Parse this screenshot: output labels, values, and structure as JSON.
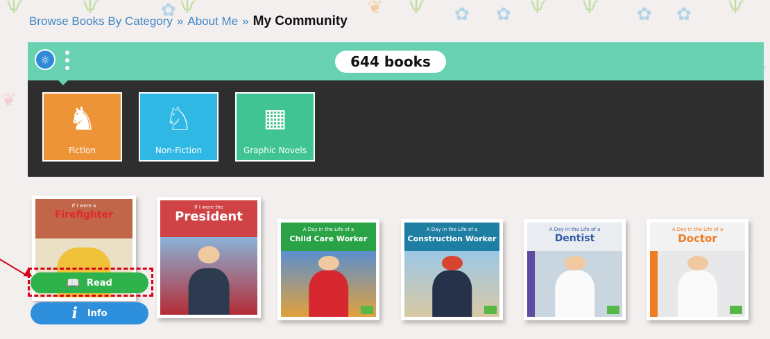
{
  "breadcrumb": {
    "items": [
      "Browse Books By Category",
      "About Me"
    ],
    "separator": "»",
    "current": "My Community"
  },
  "panel": {
    "book_count": "644 books",
    "filter_icon": "lightbulb-icon",
    "categories": [
      {
        "label": "Fiction",
        "icon": "unicorn-icon",
        "color": "#ed9438"
      },
      {
        "label": "Non-Fiction",
        "icon": "horse-icon",
        "color": "#2fb8e4"
      },
      {
        "label": "Graphic Novels",
        "icon": "comic-panel-icon",
        "color": "#40c494"
      }
    ]
  },
  "books": [
    {
      "title_small": "If I were a",
      "title": "Firefighter"
    },
    {
      "title_small": "If I were the",
      "title": "President"
    },
    {
      "title_small": "A Day in the Life of a",
      "title": "Child Care Worker"
    },
    {
      "title_small": "A Day in the Life of a",
      "title": "Construction Worker"
    },
    {
      "title_small": "A Day in the Life of a",
      "title": "Dentist"
    },
    {
      "title_small": "A Day in the Life of a",
      "title": "Doctor"
    }
  ],
  "actions": {
    "read_label": "Read",
    "info_label": "Info",
    "info_icon": "i"
  }
}
